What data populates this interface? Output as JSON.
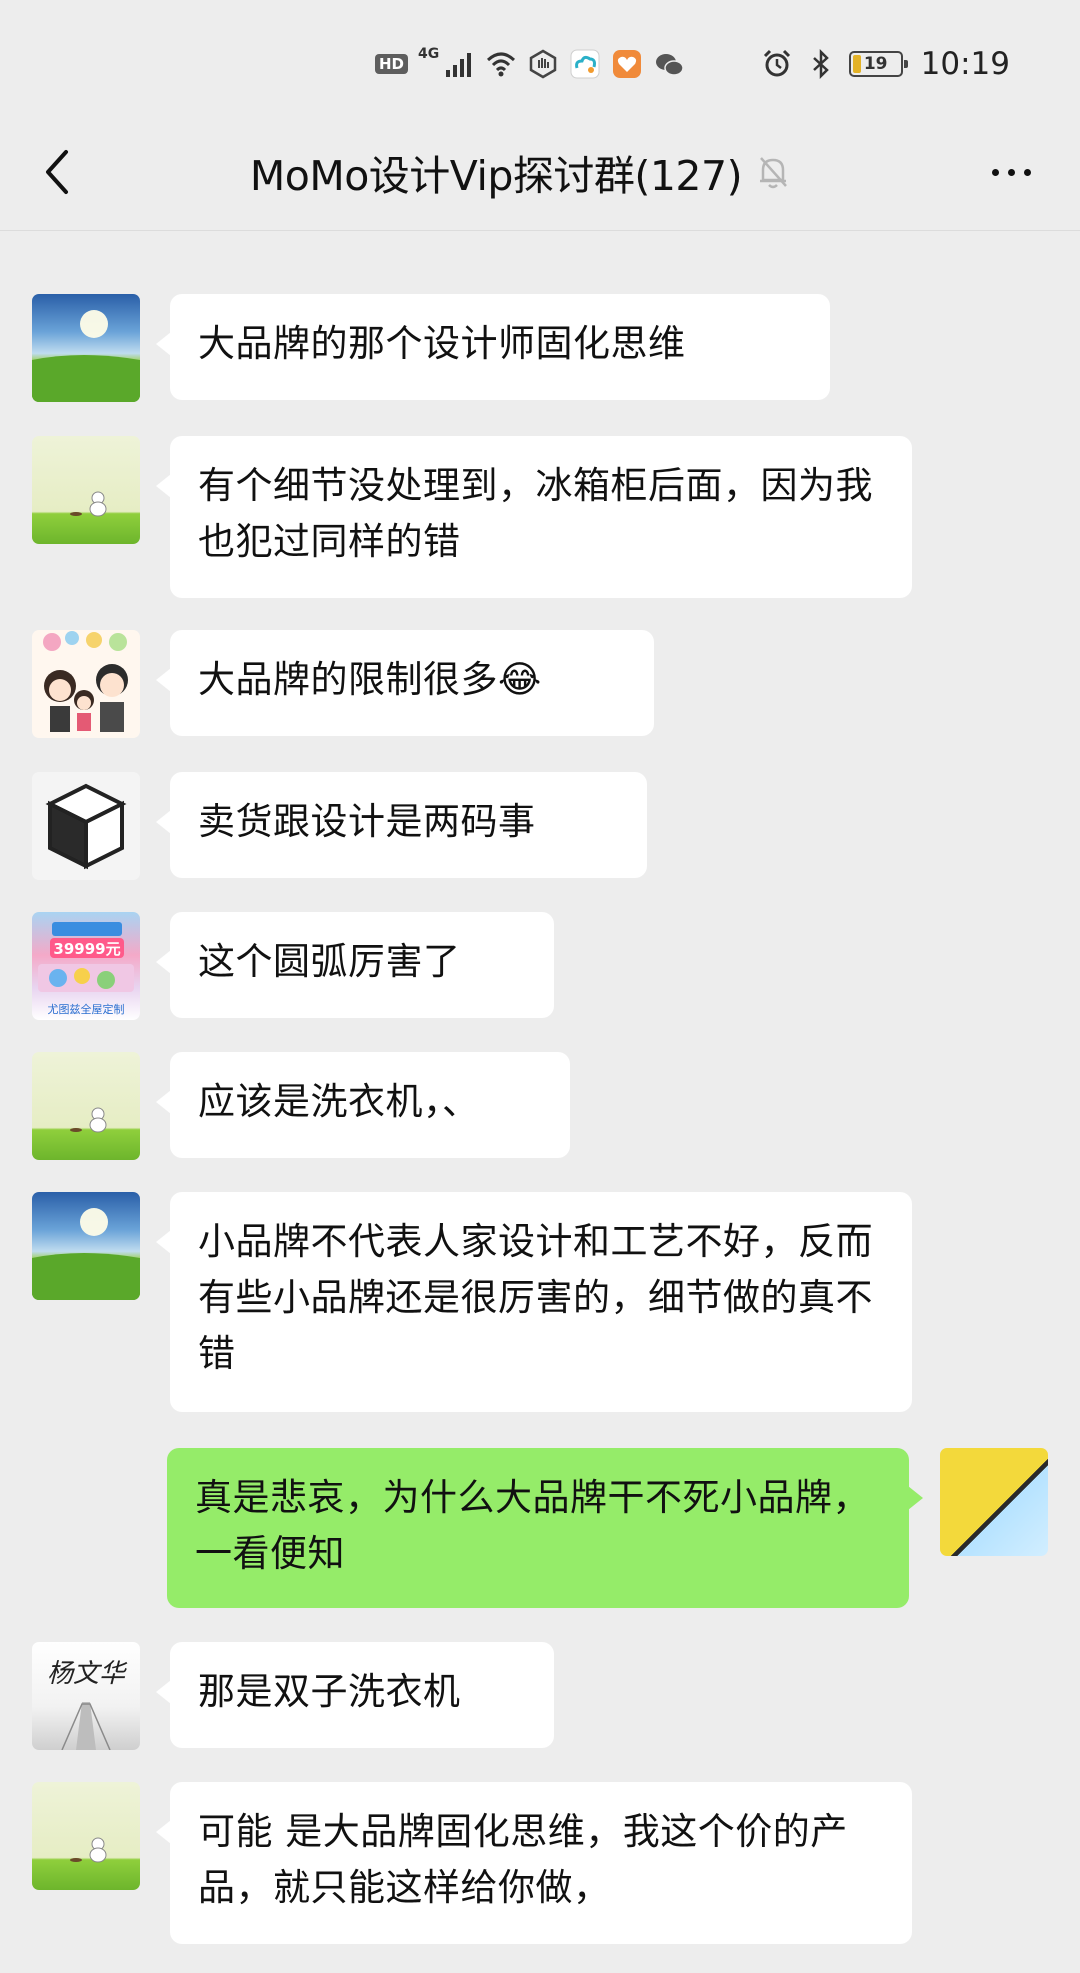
{
  "status_bar": {
    "hd": "HD",
    "network": "4G",
    "battery": "19",
    "time": "10:19"
  },
  "nav": {
    "title": "MoMo设计Vip探讨群(127)",
    "icons": {
      "back": "back-arrow-icon",
      "mute": "mute-bell-icon",
      "more": "more-dots-icon"
    }
  },
  "colors": {
    "background": "#ededed",
    "bubble_incoming": "#ffffff",
    "bubble_outgoing": "#95ec69"
  },
  "messages": [
    {
      "side": "left",
      "avatar": "sky-field-avatar",
      "text": "大品牌的那个设计师固化思维"
    },
    {
      "side": "left",
      "avatar": "snowman-field-avatar",
      "text": "有个细节没处理到，冰箱柜后面，因为我也犯过同样的错"
    },
    {
      "side": "left",
      "avatar": "cartoon-family-avatar",
      "text": "大品牌的限制很多😂"
    },
    {
      "side": "left",
      "avatar": "cube-avatar",
      "text": "卖货跟设计是两码事"
    },
    {
      "side": "left",
      "avatar": "ad-poster-avatar",
      "text": "这个圆弧厉害了",
      "avatar_text": [
        "39999元",
        "尤图兹全屋定制"
      ]
    },
    {
      "side": "left",
      "avatar": "snowman-field-avatar",
      "text": "应该是洗衣机，、"
    },
    {
      "side": "left",
      "avatar": "sky-field-avatar",
      "text": "小品牌不代表人家设计和工艺不好，反而有些小品牌还是很厉害的，细节做的真不错"
    },
    {
      "side": "right",
      "avatar": "yellow-abstract-avatar",
      "text": "真是悲哀，为什么大品牌干不死小品牌，一看便知"
    },
    {
      "side": "left",
      "avatar": "calligraphy-avatar",
      "text": "那是双子洗衣机",
      "avatar_text": [
        "杨文华"
      ]
    },
    {
      "side": "left",
      "avatar": "snowman-field-avatar",
      "text": "可能 是大品牌固化思维，我这个价的产品，就只能这样给你做，"
    }
  ]
}
